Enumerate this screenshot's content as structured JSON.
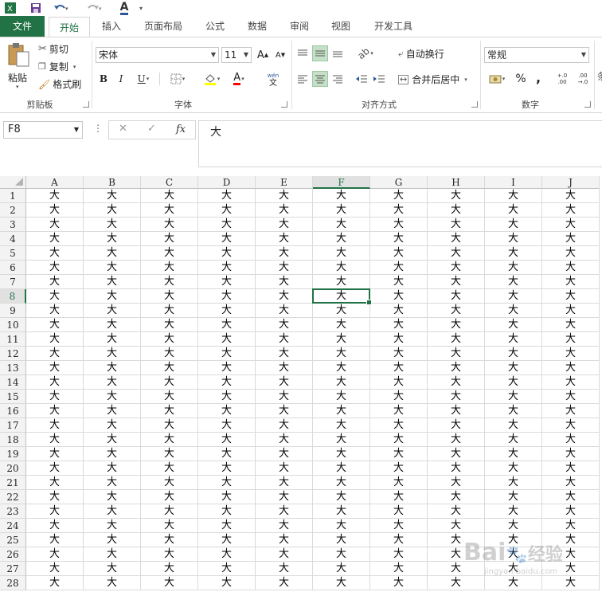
{
  "app": {
    "accent": "#217346"
  },
  "quick_access": {
    "undo_icon": "undo-icon",
    "redo_icon": "redo-icon",
    "save_icon": "save-icon",
    "font_color_letter": "A"
  },
  "tabs": [
    {
      "label": "文件"
    },
    {
      "label": "开始"
    },
    {
      "label": "插入"
    },
    {
      "label": "页面布局"
    },
    {
      "label": "公式"
    },
    {
      "label": "数据"
    },
    {
      "label": "审阅"
    },
    {
      "label": "视图"
    },
    {
      "label": "开发工具"
    }
  ],
  "ribbon": {
    "clipboard": {
      "paste": "粘贴",
      "cut": "剪切",
      "copy": "复制",
      "format_painter": "格式刷",
      "label": "剪贴板"
    },
    "font": {
      "name": "宋体",
      "size": "11",
      "bold": "B",
      "italic": "I",
      "underline": "U",
      "grow": "A",
      "shrink": "A",
      "phonetic_top": "wén",
      "phonetic_bottom": "文",
      "label": "字体"
    },
    "alignment": {
      "wrap": "自动换行",
      "merge": "合并后居中",
      "label": "对齐方式"
    },
    "number": {
      "format": "常规",
      "percent": "%",
      "comma": ",",
      "inc_decimal": "+.0 .00",
      "dec_decimal": ".00 →.0",
      "label": "数字"
    },
    "overflow_char": "条"
  },
  "formula_bar": {
    "name_box": "F8",
    "cancel": "✕",
    "enter": "✓",
    "fx": "fx",
    "content": "大"
  },
  "sheet": {
    "columns": [
      "A",
      "B",
      "C",
      "D",
      "E",
      "F",
      "G",
      "H",
      "I",
      "J"
    ],
    "selected_column": "F",
    "selected_row": 8,
    "rows": [
      {
        "num": "1",
        "cells": [
          "大",
          "大",
          "大",
          "大",
          "大",
          "大",
          "大",
          "大",
          "大",
          "大"
        ]
      },
      {
        "num": "2",
        "cells": [
          "大",
          "大",
          "大",
          "大",
          "大",
          "大",
          "大",
          "大",
          "大",
          "大"
        ]
      },
      {
        "num": "3",
        "cells": [
          "大",
          "大",
          "大",
          "大",
          "大",
          "大",
          "大",
          "大",
          "大",
          "大"
        ]
      },
      {
        "num": "4",
        "cells": [
          "大",
          "大",
          "大",
          "大",
          "大",
          "大",
          "大",
          "大",
          "大",
          "大"
        ]
      },
      {
        "num": "5",
        "cells": [
          "大",
          "大",
          "大",
          "大",
          "大",
          "大",
          "大",
          "大",
          "大",
          "大"
        ]
      },
      {
        "num": "6",
        "cells": [
          "大",
          "大",
          "大",
          "大",
          "大",
          "大",
          "大",
          "大",
          "大",
          "大"
        ]
      },
      {
        "num": "7",
        "cells": [
          "大",
          "大",
          "大",
          "大",
          "大",
          "大",
          "大",
          "大",
          "大",
          "大"
        ]
      },
      {
        "num": "8",
        "cells": [
          "大",
          "大",
          "大",
          "大",
          "大",
          "大",
          "大",
          "大",
          "大",
          "大"
        ]
      },
      {
        "num": "9",
        "cells": [
          "大",
          "大",
          "大",
          "大",
          "大",
          "大",
          "大",
          "大",
          "大",
          "大"
        ]
      },
      {
        "num": "10",
        "cells": [
          "大",
          "大",
          "大",
          "大",
          "大",
          "大",
          "大",
          "大",
          "大",
          "大"
        ]
      },
      {
        "num": "11",
        "cells": [
          "大",
          "大",
          "大",
          "大",
          "大",
          "大",
          "大",
          "大",
          "大",
          "大"
        ]
      },
      {
        "num": "12",
        "cells": [
          "大",
          "大",
          "大",
          "大",
          "大",
          "大",
          "大",
          "大",
          "大",
          "大"
        ]
      },
      {
        "num": "13",
        "cells": [
          "大",
          "大",
          "大",
          "大",
          "大",
          "大",
          "大",
          "大",
          "大",
          "大"
        ]
      },
      {
        "num": "14",
        "cells": [
          "大",
          "大",
          "大",
          "大",
          "大",
          "大",
          "大",
          "大",
          "大",
          "大"
        ]
      },
      {
        "num": "15",
        "cells": [
          "大",
          "大",
          "大",
          "大",
          "大",
          "大",
          "大",
          "大",
          "大",
          "大"
        ]
      },
      {
        "num": "16",
        "cells": [
          "大",
          "大",
          "大",
          "大",
          "大",
          "大",
          "大",
          "大",
          "大",
          "大"
        ]
      },
      {
        "num": "17",
        "cells": [
          "大",
          "大",
          "大",
          "大",
          "大",
          "大",
          "大",
          "大",
          "大",
          "大"
        ]
      },
      {
        "num": "18",
        "cells": [
          "大",
          "大",
          "大",
          "大",
          "大",
          "大",
          "大",
          "大",
          "大",
          "大"
        ]
      },
      {
        "num": "19",
        "cells": [
          "大",
          "大",
          "大",
          "大",
          "大",
          "大",
          "大",
          "大",
          "大",
          "大"
        ]
      },
      {
        "num": "20",
        "cells": [
          "大",
          "大",
          "大",
          "大",
          "大",
          "大",
          "大",
          "大",
          "大",
          "大"
        ]
      },
      {
        "num": "21",
        "cells": [
          "大",
          "大",
          "大",
          "大",
          "大",
          "大",
          "大",
          "大",
          "大",
          "大"
        ]
      },
      {
        "num": "22",
        "cells": [
          "大",
          "大",
          "大",
          "大",
          "大",
          "大",
          "大",
          "大",
          "大",
          "大"
        ]
      },
      {
        "num": "23",
        "cells": [
          "大",
          "大",
          "大",
          "大",
          "大",
          "大",
          "大",
          "大",
          "大",
          "大"
        ]
      },
      {
        "num": "24",
        "cells": [
          "大",
          "大",
          "大",
          "大",
          "大",
          "大",
          "大",
          "大",
          "大",
          "大"
        ]
      },
      {
        "num": "25",
        "cells": [
          "大",
          "大",
          "大",
          "大",
          "大",
          "大",
          "大",
          "大",
          "大",
          "大"
        ]
      },
      {
        "num": "26",
        "cells": [
          "大",
          "大",
          "大",
          "大",
          "大",
          "大",
          "大",
          "大",
          "大",
          "大"
        ]
      },
      {
        "num": "27",
        "cells": [
          "大",
          "大",
          "大",
          "大",
          "大",
          "大",
          "大",
          "大",
          "大",
          "大"
        ]
      },
      {
        "num": "28",
        "cells": [
          "大",
          "大",
          "大",
          "大",
          "大",
          "大",
          "大",
          "大",
          "大",
          "大"
        ]
      }
    ]
  },
  "watermark": {
    "brand_a": "Bai",
    "brand_b": "经验",
    "sub": "jingyan.baidu.com"
  }
}
